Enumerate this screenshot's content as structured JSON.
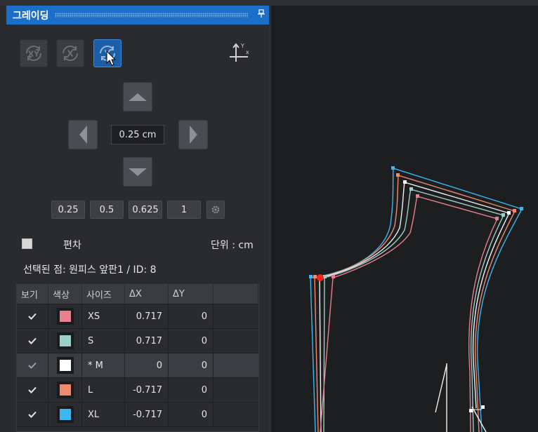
{
  "panel": {
    "title": "그레이딩",
    "pin_icon": "pin-icon"
  },
  "mode_buttons": [
    {
      "name": "xy-mode-button",
      "icon": "xy-circle-icon",
      "label": "XY",
      "active": false
    },
    {
      "name": "x-mode-button",
      "icon": "x-circle-icon",
      "label": "X",
      "active": false
    },
    {
      "name": "y-mode-button",
      "icon": "y-circle-icon",
      "label": "Y",
      "active": true
    }
  ],
  "axis_icon": {
    "x": "x",
    "y": "Y"
  },
  "step": {
    "value": "0.25 cm"
  },
  "presets": [
    "0.25",
    "0.5",
    "0.625",
    "1"
  ],
  "deviation": {
    "label": "편차",
    "checked": false
  },
  "unit": {
    "label": "단위 : cm"
  },
  "selected_point": "선택된 점: 원피스 앞판1 / ID: 8",
  "table": {
    "headers": [
      "보기",
      "색상",
      "사이즈",
      "ΔX",
      "ΔY"
    ],
    "rows": [
      {
        "view": true,
        "color": "#e8808f",
        "size": "XS",
        "dx": "0.717",
        "dy": "0"
      },
      {
        "view": true,
        "color": "#9ccfc8",
        "size": "S",
        "dx": "0.717",
        "dy": "0"
      },
      {
        "view": true,
        "color": "#ffffff",
        "size": "* M",
        "dx": "0",
        "dy": "0",
        "selected": true
      },
      {
        "view": true,
        "color": "#f08a6e",
        "size": "L",
        "dx": "-0.717",
        "dy": "0"
      },
      {
        "view": true,
        "color": "#3db7f0",
        "size": "XL",
        "dx": "-0.717",
        "dy": "0"
      }
    ]
  },
  "colors": {
    "accent": "#1c6fc9",
    "active_button": "#1c5fa8",
    "selected_point": "#ff2020"
  }
}
